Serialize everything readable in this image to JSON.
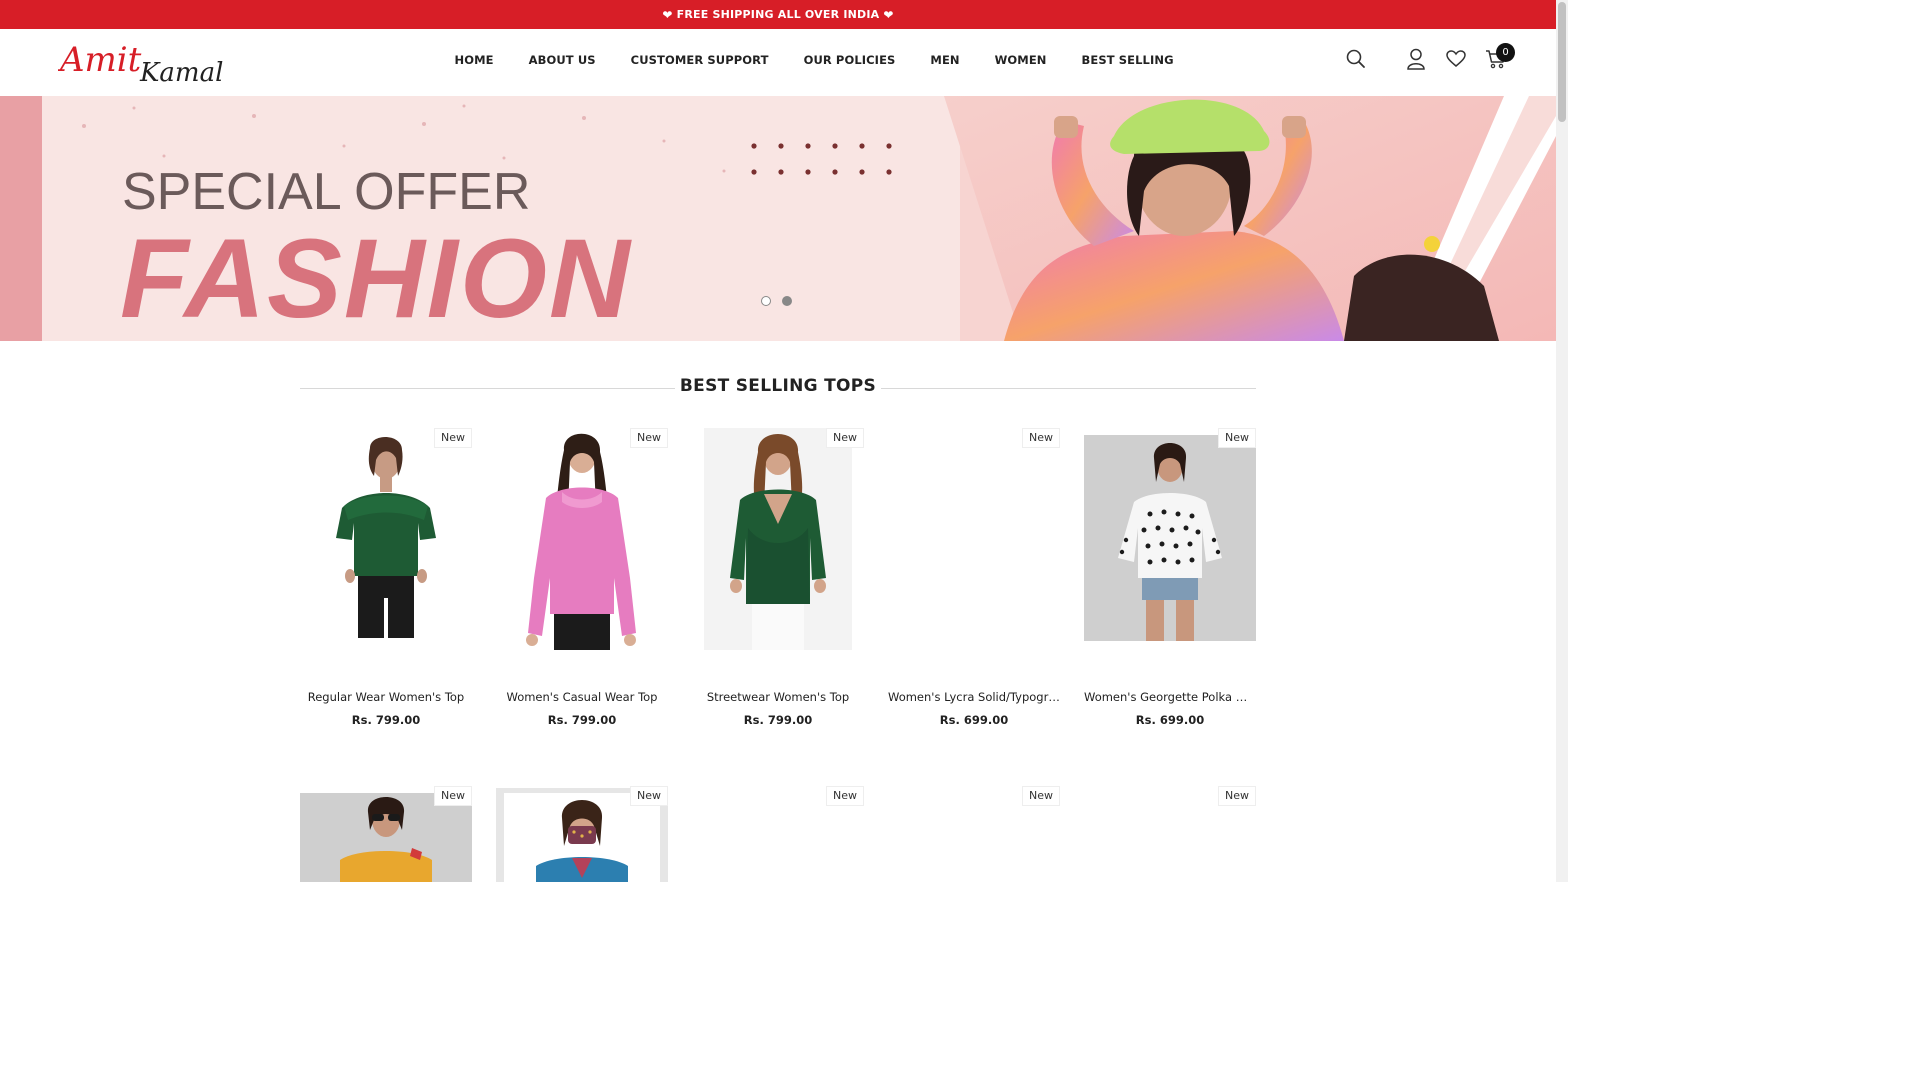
{
  "announcement": {
    "text": "FREE SHIPPING ALL OVER INDIA",
    "heart": "❤"
  },
  "brand": {
    "logo_text_1": "Amit",
    "logo_text_2": "Kamal",
    "accent": "#d71e27"
  },
  "nav": [
    {
      "label": "HOME"
    },
    {
      "label": "ABOUT US"
    },
    {
      "label": "CUSTOMER SUPPORT"
    },
    {
      "label": "OUR POLICIES"
    },
    {
      "label": "MEN"
    },
    {
      "label": "WOMEN"
    },
    {
      "label": "BEST SELLING"
    }
  ],
  "header_icons": {
    "search": "search-icon",
    "account": "user-icon",
    "wishlist": "heart-icon",
    "cart": "cart-icon",
    "cart_count": "0"
  },
  "banner": {
    "line1": "SPECIAL OFFER",
    "line2": "FASHION",
    "slides": 2,
    "active_slide": 2
  },
  "section": {
    "title": "BEST SELLING TOPS"
  },
  "products_row1": [
    {
      "badge": "New",
      "title": "Regular Wear Women's Top",
      "price": "Rs. 799.00"
    },
    {
      "badge": "New",
      "title": "Women's Casual Wear Top",
      "price": "Rs. 799.00"
    },
    {
      "badge": "New",
      "title": "Streetwear Women's Top",
      "price": "Rs. 799.00"
    },
    {
      "badge": "New",
      "title": "Women's Lycra Solid/Typographic Top",
      "price": "Rs. 699.00"
    },
    {
      "badge": "New",
      "title": "Women's Georgette Polka Dot Print Top",
      "price": "Rs. 699.00"
    }
  ],
  "products_row2": [
    {
      "badge": "New"
    },
    {
      "badge": "New"
    },
    {
      "badge": "New"
    },
    {
      "badge": "New"
    },
    {
      "badge": "New"
    }
  ]
}
